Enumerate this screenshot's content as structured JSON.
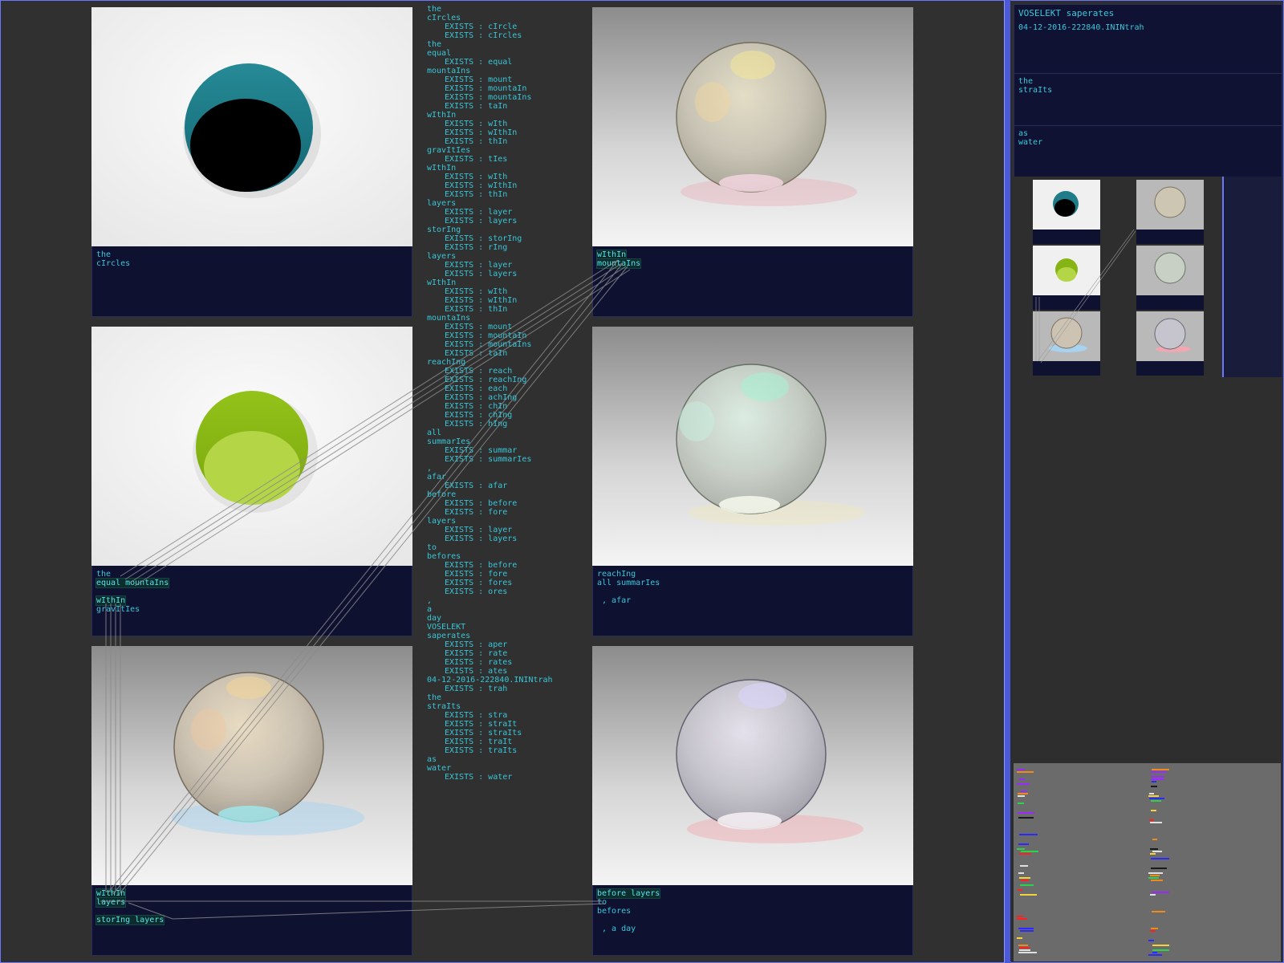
{
  "tiles": [
    {
      "id": "tile-1",
      "lines": [
        {
          "text": "the",
          "hl": false
        },
        {
          "text": "cIrcles",
          "hl": false
        }
      ]
    },
    {
      "id": "tile-2",
      "lines": [
        {
          "text": "wIthIn",
          "hl": true
        },
        {
          "text": "mountaIns",
          "hl": true
        }
      ]
    },
    {
      "id": "tile-3",
      "lines": [
        {
          "text": "the",
          "hl": false
        },
        {
          "text": "equal mountaIns",
          "hl": true
        },
        {
          "text": "",
          "hl": false
        },
        {
          "text": "wIthIn",
          "hl": true
        },
        {
          "text": "gravItIes",
          "hl": false
        }
      ]
    },
    {
      "id": "tile-4",
      "lines": [
        {
          "text": "reachIng",
          "hl": false
        },
        {
          "text": "all summarIes",
          "hl": false
        },
        {
          "text": "",
          "hl": false
        },
        {
          "text": " , afar",
          "hl": false
        }
      ]
    },
    {
      "id": "tile-5",
      "lines": [
        {
          "text": "wIthIn",
          "hl": true
        },
        {
          "text": "layers",
          "hl": true
        },
        {
          "text": "",
          "hl": false
        },
        {
          "text": "storIng layers",
          "hl": true
        }
      ]
    },
    {
      "id": "tile-6",
      "lines": [
        {
          "text": "before layers",
          "hl": true
        },
        {
          "text": "to",
          "hl": false
        },
        {
          "text": "befores",
          "hl": false
        },
        {
          "text": "",
          "hl": false
        },
        {
          "text": " , a day",
          "hl": false
        }
      ]
    }
  ],
  "wordlist": [
    {
      "w": "the",
      "ex": []
    },
    {
      "w": "cIrcles",
      "ex": [
        "EXISTS : cIrcle",
        "EXISTS : cIrcles"
      ]
    },
    {
      "w": "the",
      "ex": []
    },
    {
      "w": "equal",
      "ex": [
        "EXISTS : equal"
      ]
    },
    {
      "w": "mountaIns",
      "ex": [
        "EXISTS : mount",
        "EXISTS : mountaIn",
        "EXISTS : mountaIns",
        "EXISTS : taIn"
      ]
    },
    {
      "w": "wIthIn",
      "ex": [
        "EXISTS : wIth",
        "EXISTS : wIthIn",
        "EXISTS : thIn"
      ]
    },
    {
      "w": "gravItIes",
      "ex": [
        "EXISTS : tIes"
      ]
    },
    {
      "w": "wIthIn",
      "ex": [
        "EXISTS : wIth",
        "EXISTS : wIthIn",
        "EXISTS : thIn"
      ]
    },
    {
      "w": "layers",
      "ex": [
        "EXISTS : layer",
        "EXISTS : layers"
      ]
    },
    {
      "w": "storIng",
      "ex": [
        "EXISTS : storIng",
        "EXISTS : rIng"
      ]
    },
    {
      "w": "layers",
      "ex": [
        "EXISTS : layer",
        "EXISTS : layers"
      ]
    },
    {
      "w": "wIthIn",
      "ex": [
        "EXISTS : wIth",
        "EXISTS : wIthIn",
        "EXISTS : thIn"
      ]
    },
    {
      "w": "mountaIns",
      "ex": [
        "EXISTS : mount",
        "EXISTS : mountaIn",
        "EXISTS : mountaIns",
        "EXISTS : taIn"
      ]
    },
    {
      "w": "reachIng",
      "ex": [
        "EXISTS : reach",
        "EXISTS : reachIng",
        "EXISTS : each",
        "EXISTS : achIng",
        "EXISTS : chIn",
        "EXISTS : chIng",
        "EXISTS : hIng"
      ]
    },
    {
      "w": "all",
      "ex": []
    },
    {
      "w": "summarIes",
      "ex": [
        "EXISTS : summar",
        "EXISTS : summarIes"
      ]
    },
    {
      "w": ",",
      "ex": []
    },
    {
      "w": "afar",
      "ex": [
        "EXISTS : afar"
      ]
    },
    {
      "w": "before",
      "ex": [
        "EXISTS : before",
        "EXISTS : fore"
      ]
    },
    {
      "w": "layers",
      "ex": [
        "EXISTS : layer",
        "EXISTS : layers"
      ]
    },
    {
      "w": "to",
      "ex": []
    },
    {
      "w": "befores",
      "ex": [
        "EXISTS : before",
        "EXISTS : fore",
        "EXISTS : fores",
        "EXISTS : ores"
      ]
    },
    {
      "w": ",",
      "ex": []
    },
    {
      "w": "a",
      "ex": []
    },
    {
      "w": "day",
      "ex": []
    },
    {
      "w": "VOSELEKT",
      "ex": []
    },
    {
      "w": "saperates",
      "ex": [
        "EXISTS : aper",
        "EXISTS : rate",
        "EXISTS : rates",
        "EXISTS : ates"
      ]
    },
    {
      "w": "04-12-2016-222840.ININtrah",
      "ex": [
        "EXISTS : trah"
      ]
    },
    {
      "w": "the",
      "ex": []
    },
    {
      "w": "straIts",
      "ex": [
        "EXISTS : stra",
        "EXISTS : straIt",
        "EXISTS : straIts",
        "EXISTS : traIt",
        "EXISTS : traIts"
      ]
    },
    {
      "w": "as",
      "ex": []
    },
    {
      "w": "water",
      "ex": [
        "EXISTS : water"
      ]
    }
  ],
  "info": {
    "title": "VOSELEKT saperates",
    "file": "04-12-2016-222840.ININtrah",
    "block2": [
      "the",
      "straIts"
    ],
    "block3": [
      "as",
      "water"
    ]
  },
  "colors": {
    "caption_bg": "#0f1131",
    "text": "#39c7d9",
    "accent": "#4c5ad8"
  }
}
